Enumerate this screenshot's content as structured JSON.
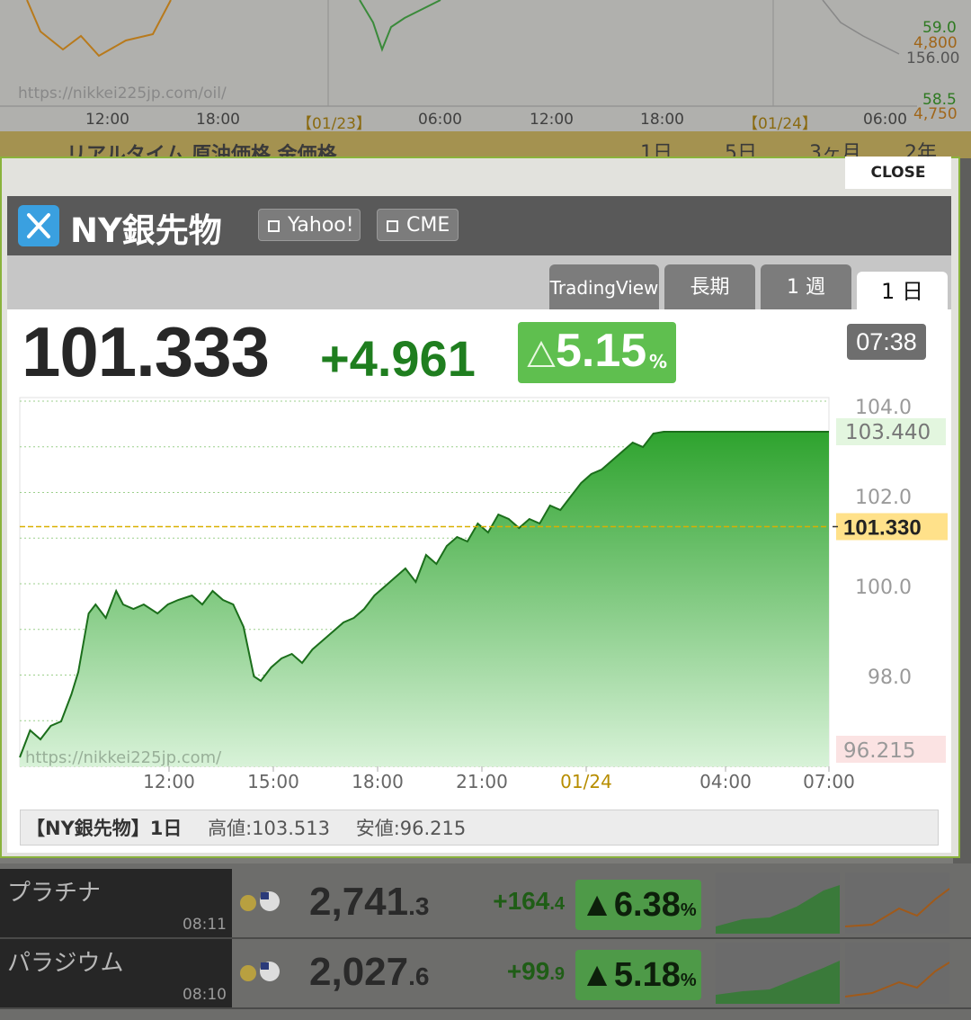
{
  "background": {
    "url": "https://nikkei225jp.com/oil/",
    "time_ticks": [
      "12:00",
      "18:00",
      "【01/23】",
      "06:00",
      "12:00",
      "18:00",
      "【01/24】",
      "06:00"
    ],
    "right_values": [
      "59.0",
      "4,800",
      "156.00",
      "58.5",
      "4,750"
    ],
    "strip_title": "リアルタイム 原油価格 金価格",
    "strip_tabs": [
      "1日",
      "5日",
      "3ヶ月",
      "2年"
    ],
    "rows": [
      {
        "name": "プラチナ",
        "time": "08:11",
        "price_main": "2,741",
        "price_dec": ".3",
        "change_main": "+164",
        "change_dec": ".4",
        "pct_main": "6.38",
        "pct_unit": "%"
      },
      {
        "name": "パラジウム",
        "time": "08:10",
        "price_main": "2,027",
        "price_dec": ".6",
        "change_main": "+99",
        "change_dec": ".9",
        "pct_main": "5.18",
        "pct_unit": "%"
      }
    ]
  },
  "modal": {
    "close_label": "CLOSE",
    "title": "NY銀先物",
    "links": [
      {
        "label": "Yahoo!"
      },
      {
        "label": "CME"
      }
    ],
    "tabs": [
      {
        "label": "TradingView"
      },
      {
        "label": "長期"
      },
      {
        "label": "1 週"
      },
      {
        "label": "1 日"
      }
    ],
    "price": "101.333",
    "change": "+4.961",
    "change_pct": "5.15",
    "pct_unit": "%",
    "time": "07:38",
    "footer": {
      "name": "【NY銀先物】1日",
      "high": "高値:103.513",
      "low": "安値:96.215"
    }
  },
  "colors": {
    "up": "#1f7e1f",
    "badge": "#5fbf4f",
    "ref_line": "#d9b000",
    "area_top": "#2ea32e",
    "area_bottom": "#d8f2d8"
  },
  "chart_data": {
    "type": "area",
    "watermark": "https://nikkei225jp.com/",
    "x_ticks": [
      "12:00",
      "15:00",
      "18:00",
      "21:00",
      "01/24",
      "04:00",
      "07:00"
    ],
    "y_ticks": [
      "104.0",
      "102.0",
      "100.0",
      "98.0"
    ],
    "ylim": [
      96.0,
      104.2
    ],
    "last_label": "103.440",
    "ref_label": "101.330",
    "low_label": "96.215",
    "ref_value": 101.33,
    "grid": true,
    "series": [
      {
        "x": [
          0,
          0.3,
          0.6,
          0.9,
          1.2,
          1.5,
          1.7,
          2.0,
          2.2,
          2.5,
          2.8,
          3.0,
          3.3,
          3.6,
          4.0,
          4.3,
          4.6,
          5.0,
          5.3,
          5.6,
          5.9,
          6.2,
          6.5,
          6.8,
          7.0,
          7.3,
          7.6,
          7.9,
          8.2,
          8.5,
          8.8,
          9.1,
          9.4,
          9.7,
          10.0,
          10.3,
          10.6,
          10.9,
          11.2,
          11.5,
          11.8,
          12.1,
          12.4,
          12.7,
          13.0,
          13.3,
          13.6,
          13.9,
          14.2,
          14.5,
          14.8,
          15.1,
          15.4,
          15.7,
          16.0,
          16.3,
          16.6,
          16.9,
          17.2,
          17.5,
          17.8,
          18.1,
          18.4,
          18.7,
          19.0,
          19.3,
          19.6,
          19.9,
          20.2,
          20.5,
          20.8,
          21.1,
          21.4,
          21.7,
          22.0,
          22.3,
          22.6,
          22.9,
          23.2,
          23.5
        ],
        "values": [
          96.2,
          96.8,
          96.6,
          96.9,
          97.0,
          97.6,
          98.1,
          99.4,
          99.6,
          99.3,
          99.9,
          99.6,
          99.5,
          99.6,
          99.4,
          99.6,
          99.7,
          99.8,
          99.6,
          99.9,
          99.7,
          99.6,
          99.1,
          98.0,
          97.9,
          98.2,
          98.4,
          98.5,
          98.3,
          98.6,
          98.8,
          99.0,
          99.2,
          99.3,
          99.5,
          99.8,
          100.0,
          100.2,
          100.4,
          100.1,
          100.7,
          100.5,
          100.9,
          101.1,
          101.0,
          101.4,
          101.2,
          101.6,
          101.5,
          101.3,
          101.5,
          101.4,
          101.8,
          101.7,
          102.0,
          102.3,
          102.5,
          102.6,
          102.8,
          103.0,
          103.2,
          103.1,
          103.4,
          103.44,
          103.44,
          103.44,
          103.44,
          103.44,
          103.44,
          103.44,
          103.44,
          103.44,
          103.44,
          103.44,
          103.44,
          103.44,
          103.44,
          103.44,
          103.44,
          103.44
        ]
      }
    ]
  }
}
